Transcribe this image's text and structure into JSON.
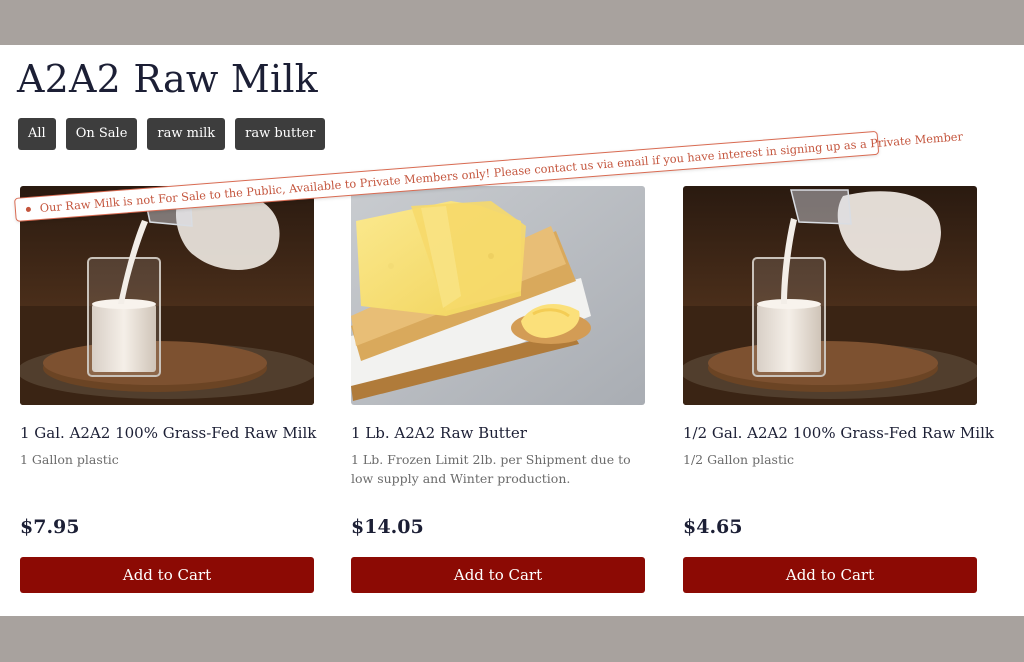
{
  "page": {
    "title": "A2A2 Raw Milk"
  },
  "filters": [
    {
      "label": "All"
    },
    {
      "label": "On Sale"
    },
    {
      "label": "raw milk"
    },
    {
      "label": "raw butter"
    }
  ],
  "notice": {
    "text": "Our Raw Milk is not For Sale to the Public, Available to Private Members only! Please contact us via email if you have interest in signing up as a Private Member"
  },
  "products": [
    {
      "title": "1 Gal. A2A2 100% Grass-Fed Raw Milk",
      "description": "1 Gallon plastic",
      "price": "$7.95",
      "button_label": "Add to Cart",
      "image": "milk-pour-photo"
    },
    {
      "title": "1 Lb. A2A2 Raw Butter",
      "description": "1 Lb. Frozen Limit 2lb. per Shipment due to low supply and Winter production.",
      "price": "$14.05",
      "button_label": "Add to Cart",
      "image": "butter-photo"
    },
    {
      "title": "1/2 Gal. A2A2 100% Grass-Fed Raw Milk",
      "description": "1/2 Gallon plastic",
      "price": "$4.65",
      "button_label": "Add to Cart",
      "image": "milk-pour-photo"
    }
  ],
  "colors": {
    "backdrop": "#a8a29e",
    "title": "#1c1f35",
    "filter_bg": "#3d3d3d",
    "cart_button": "#8c0a04",
    "notice": "#c4553d"
  }
}
